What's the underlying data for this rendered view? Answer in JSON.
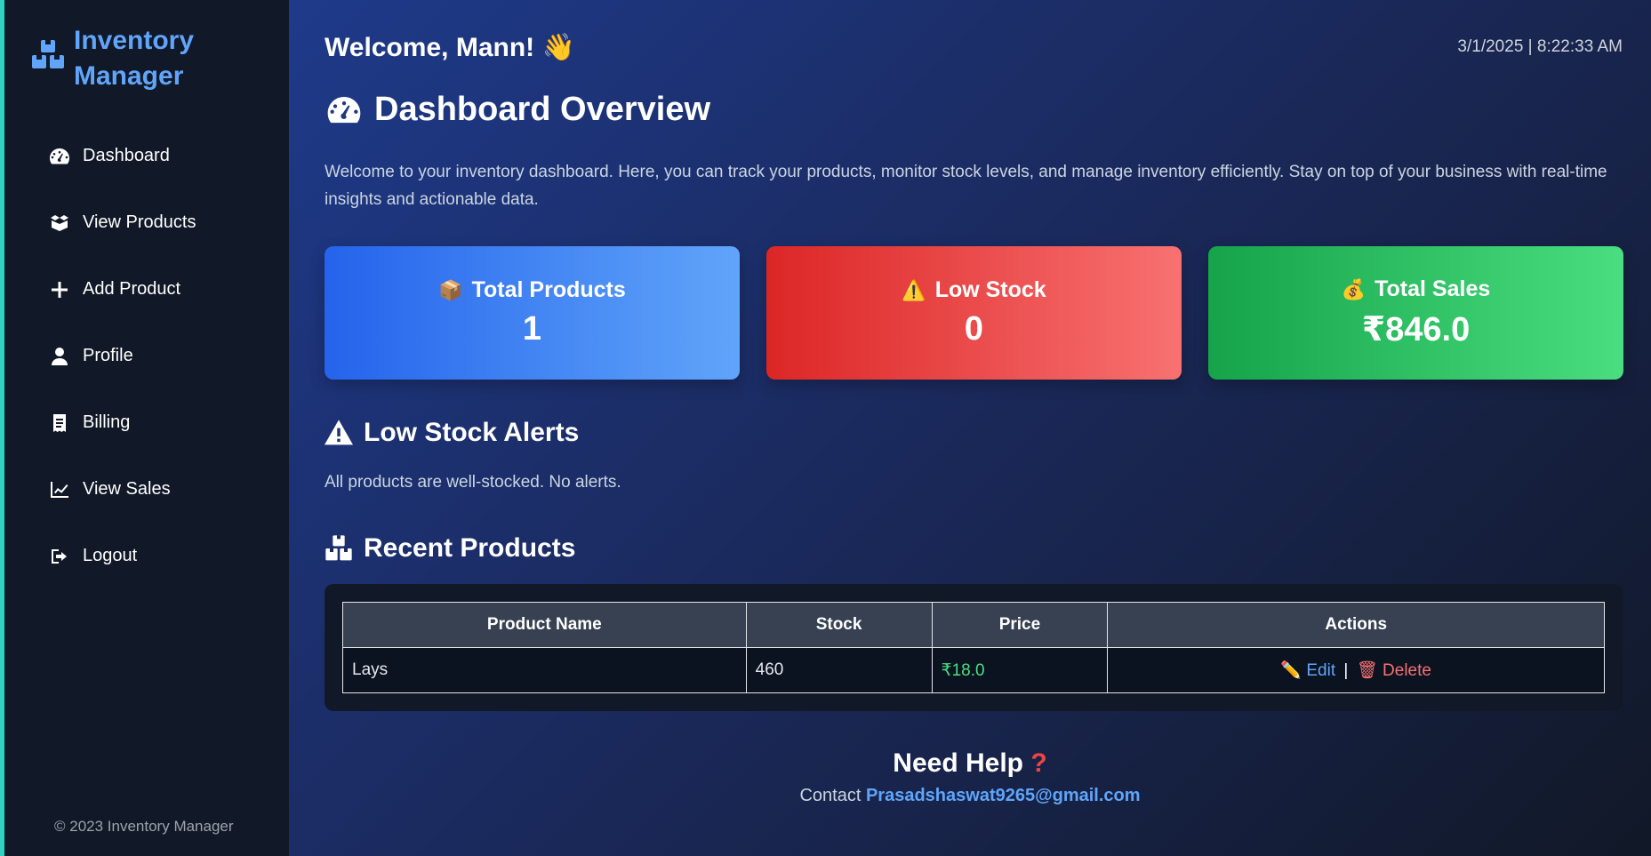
{
  "sidebar": {
    "brand_line1": "Inventory",
    "brand_line2": "Manager",
    "items": [
      {
        "label": "Dashboard",
        "icon": "gauge-icon"
      },
      {
        "label": "View Products",
        "icon": "box-icon"
      },
      {
        "label": "Add Product",
        "icon": "plus-icon"
      },
      {
        "label": "Profile",
        "icon": "user-icon"
      },
      {
        "label": "Billing",
        "icon": "receipt-icon"
      },
      {
        "label": "View Sales",
        "icon": "chart-line-icon"
      },
      {
        "label": "Logout",
        "icon": "logout-icon"
      }
    ],
    "footer": "© 2023 Inventory Manager"
  },
  "header": {
    "welcome": "Welcome, Mann!",
    "welcome_emoji": "👋",
    "datetime": "3/1/2025 | 8:22:33 AM"
  },
  "overview": {
    "title": "Dashboard Overview",
    "intro": "Welcome to your inventory dashboard. Here, you can track your products, monitor stock levels, and manage inventory efficiently. Stay on top of your business with real-time insights and actionable data."
  },
  "cards": [
    {
      "emoji": "📦",
      "label": "Total Products",
      "value": "1",
      "color": "#2563eb"
    },
    {
      "emoji": "⚠️",
      "label": "Low Stock",
      "value": "0",
      "color": "#dc2626"
    },
    {
      "emoji": "💰",
      "label": "Total Sales",
      "value": "₹846.0",
      "color": "#16a34a"
    }
  ],
  "alerts": {
    "title": "Low Stock Alerts",
    "message": "All products are well-stocked. No alerts."
  },
  "recent": {
    "title": "Recent Products",
    "columns": [
      "Product Name",
      "Stock",
      "Price",
      "Actions"
    ],
    "rows": [
      {
        "name": "Lays",
        "stock": "460",
        "price": "₹18.0",
        "edit_emoji": "✏️",
        "edit": "Edit",
        "separator": "|",
        "delete_emoji": "🗑",
        "delete": "Delete"
      }
    ]
  },
  "help": {
    "title": "Need Help",
    "question": "?",
    "contact_label": "Contact",
    "email": "Prasadshaswat9265@gmail.com"
  }
}
